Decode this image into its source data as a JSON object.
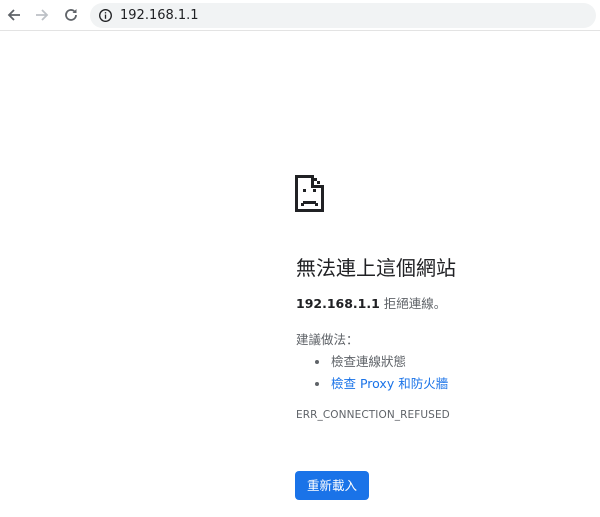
{
  "browser": {
    "url": "192.168.1.1",
    "icons": {
      "back": "arrow-left-icon",
      "forward": "arrow-right-icon",
      "reload": "reload-icon",
      "site_info": "info-icon"
    }
  },
  "error": {
    "icon": "sad-page-icon",
    "title": "無法連上這個網站",
    "host": "192.168.1.1",
    "message": " 拒絕連線。",
    "suggestions_heading": "建議做法：",
    "suggestions": [
      {
        "text": "檢查連線狀態",
        "is_link": false
      },
      {
        "text": "檢查 Proxy 和防火牆",
        "is_link": true
      }
    ],
    "code": "ERR_CONNECTION_REFUSED",
    "reload_label": "重新載入"
  },
  "colors": {
    "link": "#1a73e8",
    "button": "#1a73e8",
    "omnibox": "#f1f3f4",
    "secondary_text": "#5f6368"
  }
}
